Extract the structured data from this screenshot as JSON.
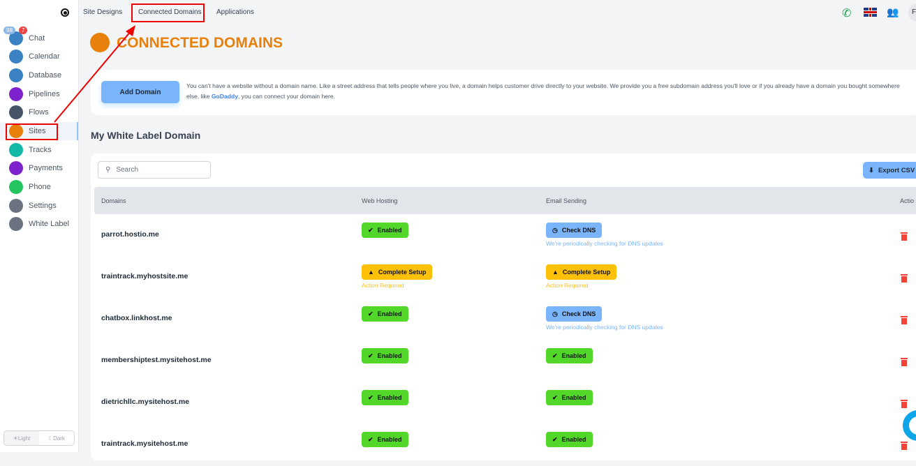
{
  "sidebar": {
    "items": [
      {
        "label": "Chat",
        "icon": "chat-icon",
        "color": "#3b82c4"
      },
      {
        "label": "Calendar",
        "icon": "calendar-icon",
        "color": "#3b82c4"
      },
      {
        "label": "Database",
        "icon": "database-icon",
        "color": "#3b82c4"
      },
      {
        "label": "Pipelines",
        "icon": "pipelines-icon",
        "color": "#7e22ce"
      },
      {
        "label": "Flows",
        "icon": "flows-icon",
        "color": "#475569"
      },
      {
        "label": "Sites",
        "icon": "lightbulb-icon",
        "color": "#e8800c"
      },
      {
        "label": "Tracks",
        "icon": "tracks-icon",
        "color": "#14b8a6"
      },
      {
        "label": "Payments",
        "icon": "payments-icon",
        "color": "#7e22ce"
      },
      {
        "label": "Phone",
        "icon": "phone-icon",
        "color": "#22c55e"
      },
      {
        "label": "Settings",
        "icon": "settings-icon",
        "color": "#6b7280"
      },
      {
        "label": "White Label",
        "icon": "white-label-icon",
        "color": "#6b7280"
      }
    ],
    "badge_blue": "98",
    "badge_red": "7",
    "theme": {
      "light": "Light",
      "dark": "Dark"
    }
  },
  "topnav": {
    "tabs": [
      "Site Designs",
      "Connected Domains",
      "Applications"
    ],
    "avatar": "F"
  },
  "page": {
    "title": "CONNECTED DOMAINS",
    "add_domain": "Add Domain",
    "info_pre": "You can't have a website without a domain name. Like a street address that tells people where you live, a domain helps customer drive directly to your website. We provide you a free subdomain address you'll love or if you already have a domain you bought somewhere else, like ",
    "info_link": "GoDaddy",
    "info_post": ", you can connect your domain here.",
    "section": "My White Label Domain",
    "search_placeholder": "Search",
    "export": "Export CSV",
    "columns": [
      "Domains",
      "Web Hosting",
      "Email Sending",
      "Actio"
    ]
  },
  "rows": [
    {
      "domain": "parrot.hostio.me",
      "web": "Enabled",
      "web_sub": "",
      "email": "Check DNS",
      "email_sub": "We're periodically checking for DNS updates"
    },
    {
      "domain": "traintrack.myhostsite.me",
      "web": "Complete Setup",
      "web_sub": "Action Required",
      "email": "Complete Setup",
      "email_sub": "Action Required"
    },
    {
      "domain": "chatbox.linkhost.me",
      "web": "Enabled",
      "web_sub": "",
      "email": "Check DNS",
      "email_sub": "We're periodically checking for DNS updates"
    },
    {
      "domain": "membershiptest.mysitehost.me",
      "web": "Enabled",
      "web_sub": "",
      "email": "Enabled",
      "email_sub": ""
    },
    {
      "domain": "dietrichllc.mysitehost.me",
      "web": "Enabled",
      "web_sub": "",
      "email": "Enabled",
      "email_sub": ""
    },
    {
      "domain": "traintrack.mysitehost.me",
      "web": "Enabled",
      "web_sub": "",
      "email": "Enabled",
      "email_sub": ""
    }
  ],
  "colors": {
    "enabled": "#52d62a",
    "check_dns": "#7ab5fb",
    "setup": "#ffc107",
    "accent": "#e8800c",
    "delete": "#f44336",
    "annotation": "#ee0000"
  }
}
